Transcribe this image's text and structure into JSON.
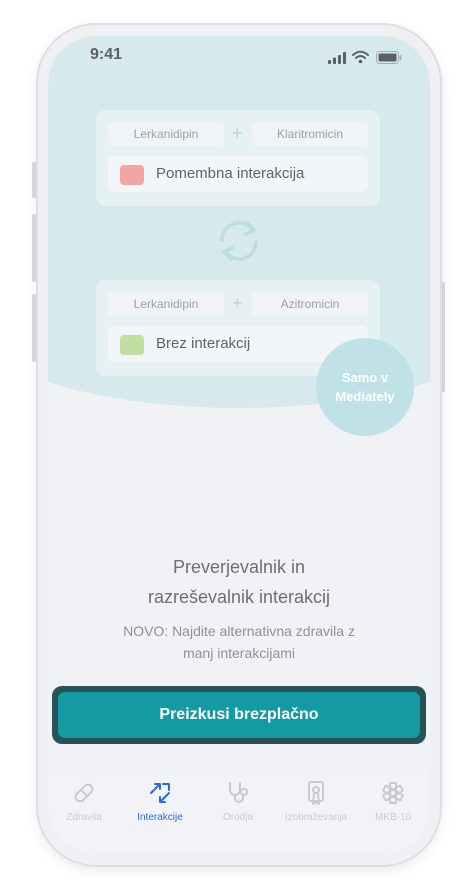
{
  "status_bar": {
    "time": "9:41"
  },
  "card_top": {
    "drug_a": "Lerkanidipin",
    "drug_b": "Klaritromicin",
    "plus": "+",
    "result": "Pomembna interakcija",
    "result_color": "#f2a5a2"
  },
  "card_bottom": {
    "drug_a": "Lerkanidipin",
    "drug_b": "Azitromicin",
    "plus": "+",
    "result": "Brez interakcij",
    "result_color": "#bfe0a0"
  },
  "badge": {
    "line1": "Samo v",
    "line2": "Mediately"
  },
  "feature": {
    "title_line1": "Preverjevalnik in",
    "title_line2": "razreševalnik interakcij",
    "subtitle_line1": "NOVO: Najdite alternativna zdravila z",
    "subtitle_line2": "manj interakcijami"
  },
  "cta": {
    "label": "Preizkusi brezplačno"
  },
  "tabs": [
    {
      "label": "Zdravila",
      "icon": "pill-icon"
    },
    {
      "label": "Interakcije",
      "icon": "interactions-arrows-icon",
      "active": true
    },
    {
      "label": "Orodja",
      "icon": "stethoscope-icon"
    },
    {
      "label": "Izobraževanja",
      "icon": "certificate-icon"
    },
    {
      "label": "MKB-10",
      "icon": "medical-star-icon"
    }
  ],
  "colors": {
    "accent": "#149aa2",
    "cta_border": "#275356",
    "active_tab": "#2b6be0",
    "hero_background": "#d6eaee"
  }
}
